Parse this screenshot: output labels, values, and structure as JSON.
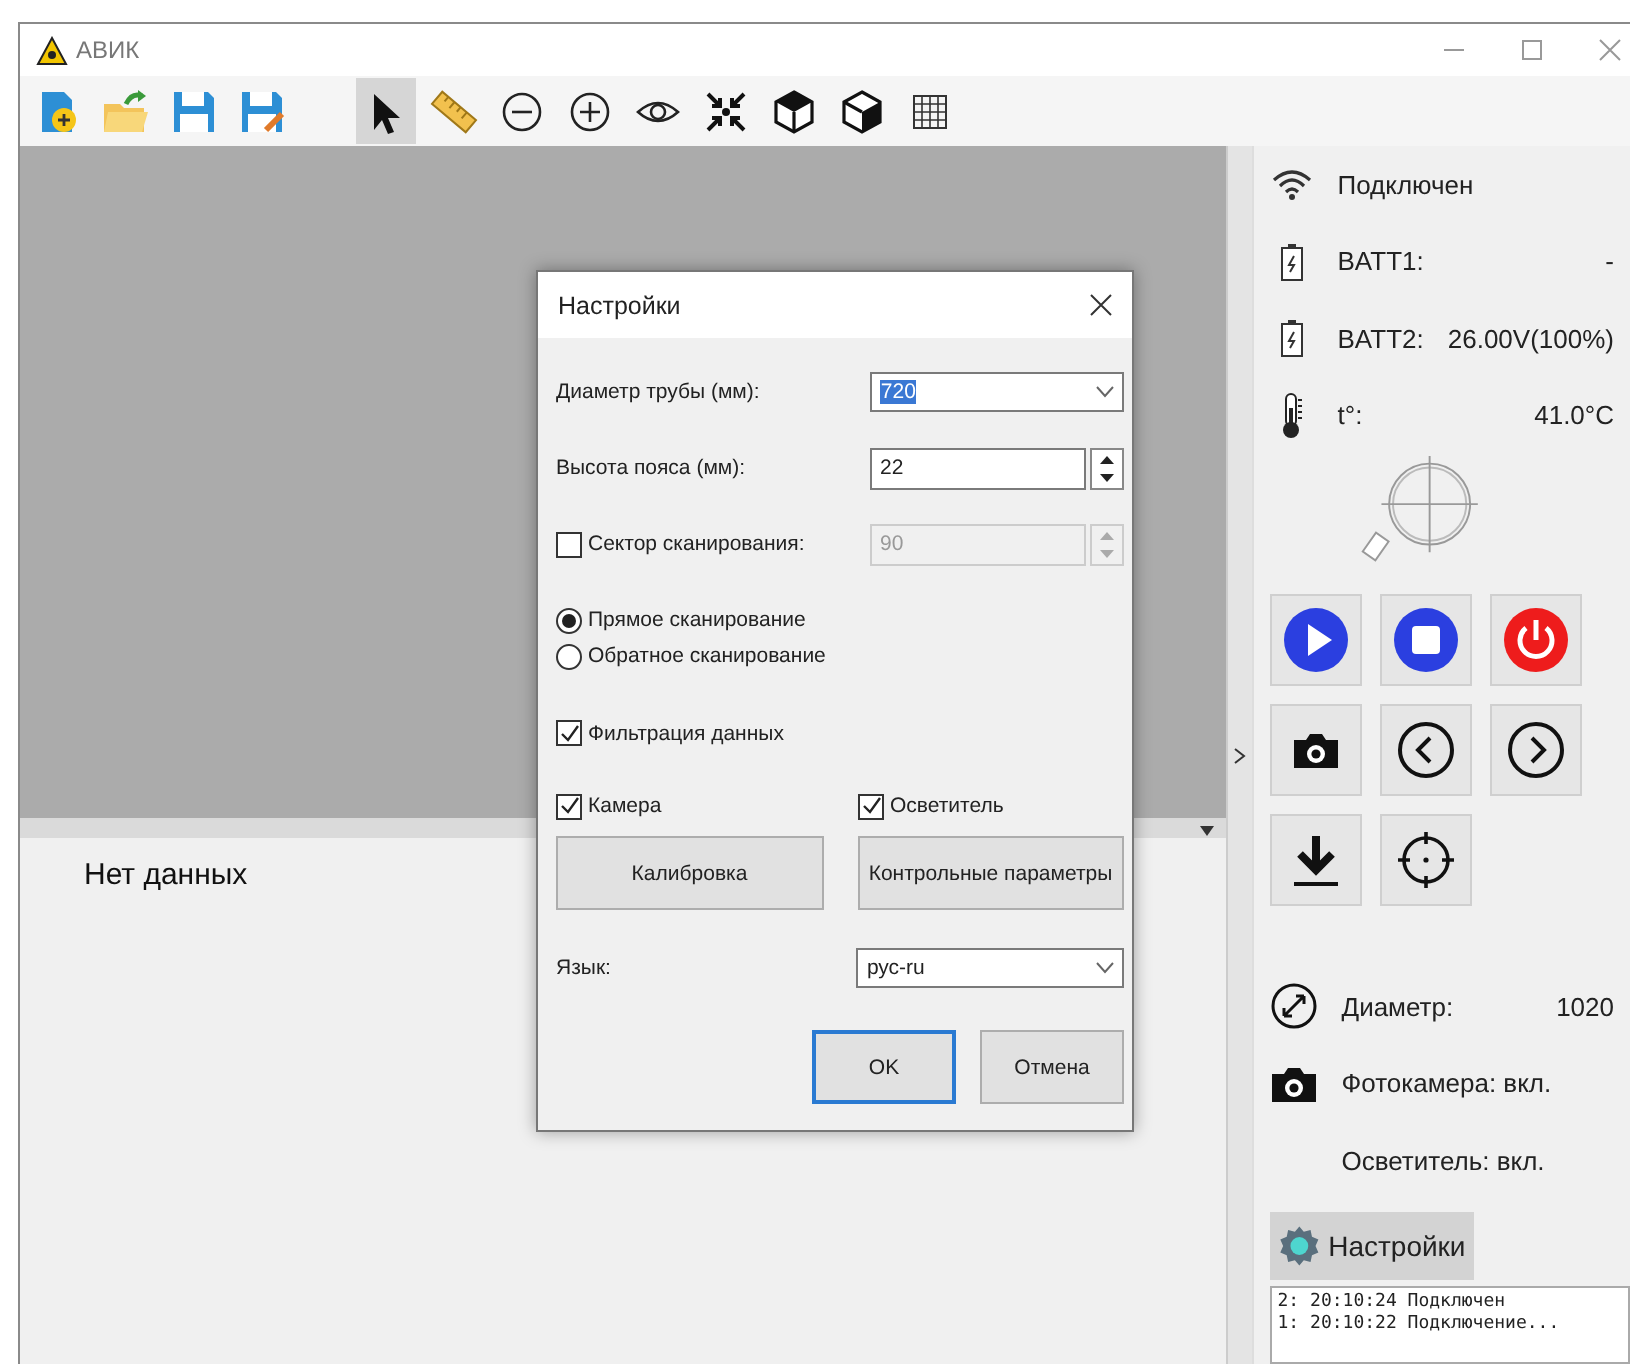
{
  "window": {
    "title": "АВИК"
  },
  "toolbar": {
    "tools": [
      {
        "selected": true
      },
      {
        "selected": false
      },
      {
        "selected": false
      },
      {
        "selected": false
      },
      {
        "selected": false
      },
      {
        "selected": false
      },
      {
        "selected": false
      },
      {
        "selected": false
      },
      {
        "selected": false
      }
    ]
  },
  "output": {
    "message": "Нет данных"
  },
  "status_panel": {
    "connection": "Подключен",
    "batteries": [
      {
        "label": "BATT1:",
        "value": "-"
      },
      {
        "label": "BATT2:",
        "value": "26.00V(100%)"
      }
    ],
    "temperature": {
      "label": "t°:",
      "value": "41.0°C"
    },
    "diameter": {
      "label": "Диаметр:",
      "value": "1020"
    },
    "camera": "Фотокамера: вкл.",
    "light": "Осветитель: вкл.",
    "settings_button": "Настройки",
    "log": [
      "2: 20:10:24 Подключен",
      "1: 20:10:22 Подключение..."
    ]
  },
  "dialog": {
    "title": "Настройки",
    "pipe_diameter": {
      "label": "Диаметр трубы (мм):",
      "value": "720"
    },
    "belt_height": {
      "label": "Высота пояса (мм):",
      "value": "22"
    },
    "scan_sector": {
      "label": "Сектор сканирования:",
      "checked": false,
      "value": "90",
      "disabled": true
    },
    "scan_modes": [
      {
        "label": "Прямое сканирование",
        "selected": true
      },
      {
        "label": "Обратное сканирование",
        "selected": false
      }
    ],
    "filter": {
      "label": "Фильтрация данных",
      "checked": true
    },
    "camera": {
      "label": "Камера",
      "checked": true
    },
    "light": {
      "label": "Осветитель",
      "checked": true
    },
    "buttons": [
      "Калибровка",
      "Контрольные параметры"
    ],
    "language": {
      "label": "Язык:",
      "value": "рус-ru"
    },
    "actions": [
      {
        "label": "OK",
        "default": true
      },
      {
        "label": "Отмена",
        "default": false
      }
    ]
  }
}
